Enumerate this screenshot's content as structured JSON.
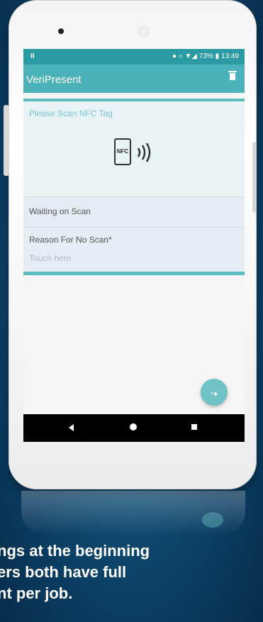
{
  "status_bar": {
    "left_icon": "II",
    "right": "● ○ ▼◢ 73% ▮ 13:49"
  },
  "app": {
    "title": "VeriPresent",
    "trash_icon": "trash-icon"
  },
  "scan_card": {
    "label": "Please Scan NFC Tag",
    "nfc_text": "NFC"
  },
  "status_card": {
    "label": "Waiting on Scan"
  },
  "reason_card": {
    "label": "Reason For No Scan*",
    "placeholder": "Touch here"
  },
  "fab": {
    "icon": "forward-arrow-icon"
  },
  "navbar": {
    "back_icon": "back-icon",
    "home_icon": "home-icon",
    "recent_icon": "recent-apps-icon"
  },
  "caption": {
    "line1": "ngs at the beginning",
    "line2": "ers both have full",
    "line3": "nt per job."
  },
  "colors": {
    "appbar": "#4ab2b8",
    "statusbar": "#2a9aa3",
    "accent": "#5fbcc0",
    "background": "#0f4f77"
  }
}
